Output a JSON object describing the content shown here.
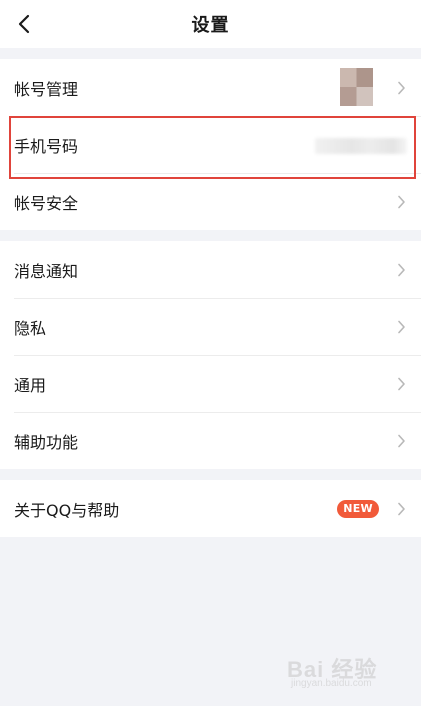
{
  "header": {
    "title": "设置",
    "back_icon": "chevron-left-icon"
  },
  "groups": [
    {
      "items": [
        {
          "label": "帐号管理",
          "right": "avatar"
        },
        {
          "label": "手机号码",
          "right": "phone-value"
        },
        {
          "label": "帐号安全",
          "right": "chevron"
        }
      ]
    },
    {
      "items": [
        {
          "label": "消息通知"
        },
        {
          "label": "隐私"
        },
        {
          "label": "通用"
        },
        {
          "label": "辅助功能"
        }
      ]
    },
    {
      "items": [
        {
          "label": "关于QQ与帮助",
          "badge": "NEW"
        }
      ]
    }
  ],
  "colors": {
    "background": "#f2f3f7",
    "highlight": "#e0443b",
    "badge": "#f15a3a",
    "chevron": "#b8b8b8"
  },
  "watermark": {
    "text": "Bai 经验",
    "sub": "jingyan.baidu.com"
  }
}
